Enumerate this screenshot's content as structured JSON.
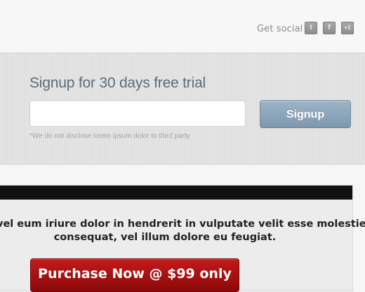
{
  "header": {
    "social_label": "Get social",
    "social_buttons": [
      {
        "icon": "twitter-icon",
        "glyph": "t"
      },
      {
        "icon": "facebook-icon",
        "glyph": "f"
      },
      {
        "icon": "google-plus-icon",
        "glyph": "+1"
      }
    ]
  },
  "signup": {
    "title": "Signup for 30 days free trial",
    "email_value": "",
    "email_placeholder": "",
    "button_label": "Signup",
    "disclaimer": "*We do not disclose lorem ipsum dolor to third party"
  },
  "card": {
    "text_line1": "vel eum iriure dolor in hendrerit in vulputate velit esse molestie",
    "text_line2": "consequat, vel illum dolore eu feugiat.",
    "purchase_label": "Purchase Now @ $99 only"
  },
  "colors": {
    "signup_button": "#7f9ab0",
    "purchase_button": "#b01212",
    "title_text": "#5c6b78"
  }
}
